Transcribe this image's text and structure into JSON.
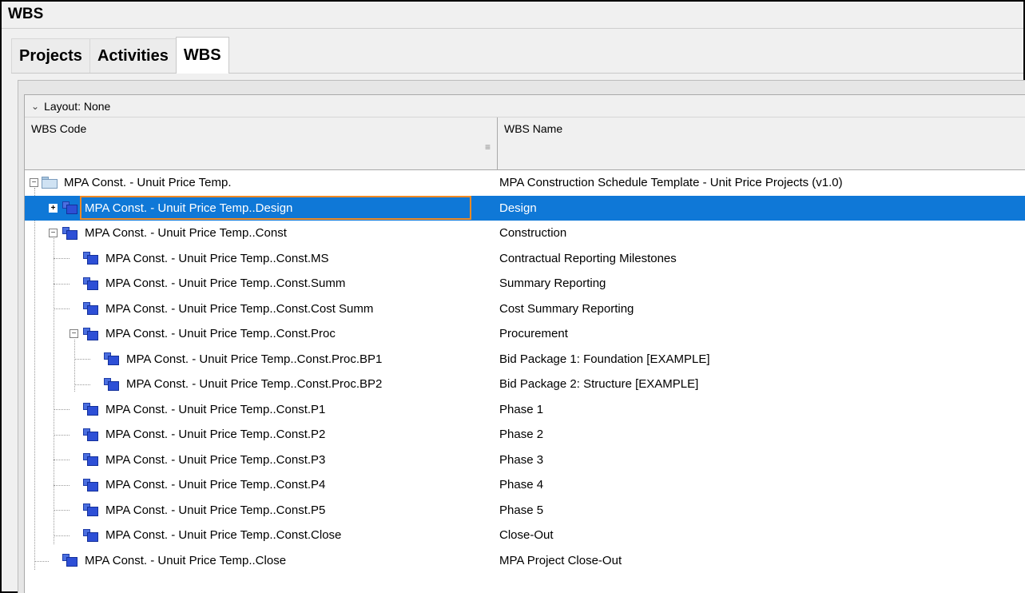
{
  "window": {
    "title": "WBS"
  },
  "tabs": [
    {
      "label": "Projects",
      "active": false
    },
    {
      "label": "Activities",
      "active": false
    },
    {
      "label": "WBS",
      "active": true
    }
  ],
  "layout_bar": {
    "label": "Layout: None"
  },
  "columns": {
    "code": "WBS Code",
    "name": "WBS Name"
  },
  "rows": [
    {
      "code": "MPA Const. - Unuit Price Temp.",
      "name": "MPA Construction Schedule Template - Unit Price Projects (v1.0)",
      "icon": "folder-icon",
      "toggle": "minus"
    },
    {
      "code": "MPA Const. - Unuit Price Temp..Design",
      "name": "Design",
      "icon": "wbs-node-icon",
      "toggle": "plus",
      "selected": true
    },
    {
      "code": "MPA Const. - Unuit Price Temp..Const",
      "name": "Construction",
      "icon": "wbs-node-icon",
      "toggle": "minus"
    },
    {
      "code": "MPA Const. - Unuit Price Temp..Const.MS",
      "name": "Contractual Reporting Milestones",
      "icon": "wbs-node-icon"
    },
    {
      "code": "MPA Const. - Unuit Price Temp..Const.Summ",
      "name": "Summary Reporting",
      "icon": "wbs-node-icon"
    },
    {
      "code": "MPA Const. - Unuit Price Temp..Const.Cost Summ",
      "name": "Cost Summary Reporting",
      "icon": "wbs-node-icon"
    },
    {
      "code": "MPA Const. - Unuit Price Temp..Const.Proc",
      "name": "Procurement",
      "icon": "wbs-node-icon",
      "toggle": "minus"
    },
    {
      "code": "MPA Const. - Unuit Price Temp..Const.Proc.BP1",
      "name": "Bid Package 1: Foundation [EXAMPLE]",
      "icon": "wbs-node-icon"
    },
    {
      "code": "MPA Const. - Unuit Price Temp..Const.Proc.BP2",
      "name": "Bid Package 2: Structure [EXAMPLE]",
      "icon": "wbs-node-icon"
    },
    {
      "code": "MPA Const. - Unuit Price Temp..Const.P1",
      "name": "Phase 1",
      "icon": "wbs-node-icon"
    },
    {
      "code": "MPA Const. - Unuit Price Temp..Const.P2",
      "name": "Phase 2",
      "icon": "wbs-node-icon"
    },
    {
      "code": "MPA Const. - Unuit Price Temp..Const.P3",
      "name": "Phase 3",
      "icon": "wbs-node-icon"
    },
    {
      "code": "MPA Const. - Unuit Price Temp..Const.P4",
      "name": "Phase 4",
      "icon": "wbs-node-icon"
    },
    {
      "code": "MPA Const. - Unuit Price Temp..Const.P5",
      "name": "Phase 5",
      "icon": "wbs-node-icon"
    },
    {
      "code": "MPA Const. - Unuit Price Temp..Const.Close",
      "name": "Close-Out",
      "icon": "wbs-node-icon"
    },
    {
      "code": "MPA Const. - Unuit Price Temp..Close",
      "name": "MPA Project Close-Out",
      "icon": "wbs-node-icon"
    }
  ],
  "colors": {
    "selection": "#0f78d7",
    "focus_border": "#f08a24",
    "wbs_icon": "#2d4fd6"
  }
}
